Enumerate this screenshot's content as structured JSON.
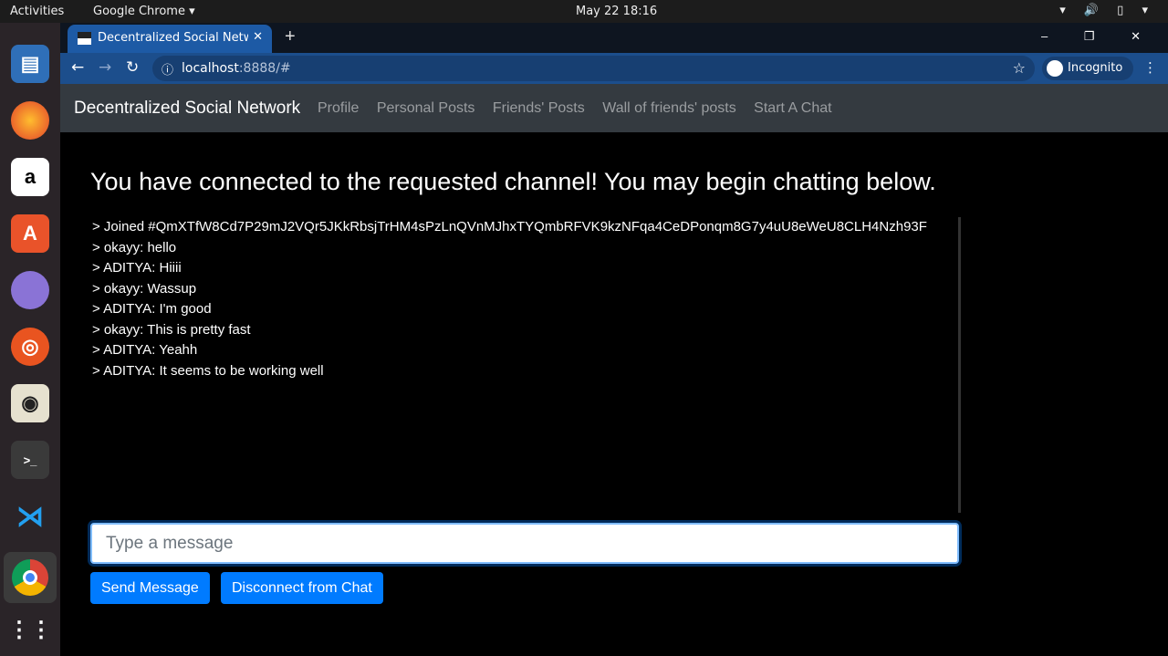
{
  "system": {
    "activities": "Activities",
    "app": "Google Chrome ▾",
    "clock": "May 22  18:16",
    "tray": "▾ 🔊 ▯ ▾"
  },
  "dock": {
    "items": [
      "writer",
      "firefox",
      "amazon",
      "software",
      "browser",
      "ubuntu",
      "rhythmbox",
      "terminal",
      "vscode",
      "chrome",
      "apps"
    ]
  },
  "browser": {
    "tab_title": "Decentralized Social Network",
    "tab_close": "✕",
    "new_tab": "+",
    "window_controls": "– ❐ ✕",
    "url_host": "localhost",
    "url_rest": ":8888/#",
    "incognito": "Incognito",
    "menu": "⋮"
  },
  "navbar": {
    "brand": "Decentralized Social Network",
    "links": [
      "Profile",
      "Personal Posts",
      "Friends' Posts",
      "Wall of friends' posts",
      "Start A Chat"
    ]
  },
  "main": {
    "heading": "You have connected to the requested channel! You may begin chatting below.",
    "messages": [
      "> Joined #QmXTfW8Cd7P29mJ2VQr5JKkRbsjTrHM4sPzLnQVnMJhxTYQmbRFVK9kzNFqa4CeDPonqm8G7y4uU8eWeU8CLH4Nzh93F",
      "> okayy: hello",
      "> ADITYA: Hiiii",
      "> okayy: Wassup",
      "> ADITYA: I'm good",
      "> okayy: This is pretty fast",
      "> ADITYA: Yeahh",
      "> ADITYA: It seems to be working well"
    ],
    "input_placeholder": "Type a message",
    "input_value": "",
    "send_label": "Send Message",
    "disconnect_label": "Disconnect from Chat"
  },
  "colors": {
    "accent": "#007bff",
    "navbar": "#343a40"
  }
}
